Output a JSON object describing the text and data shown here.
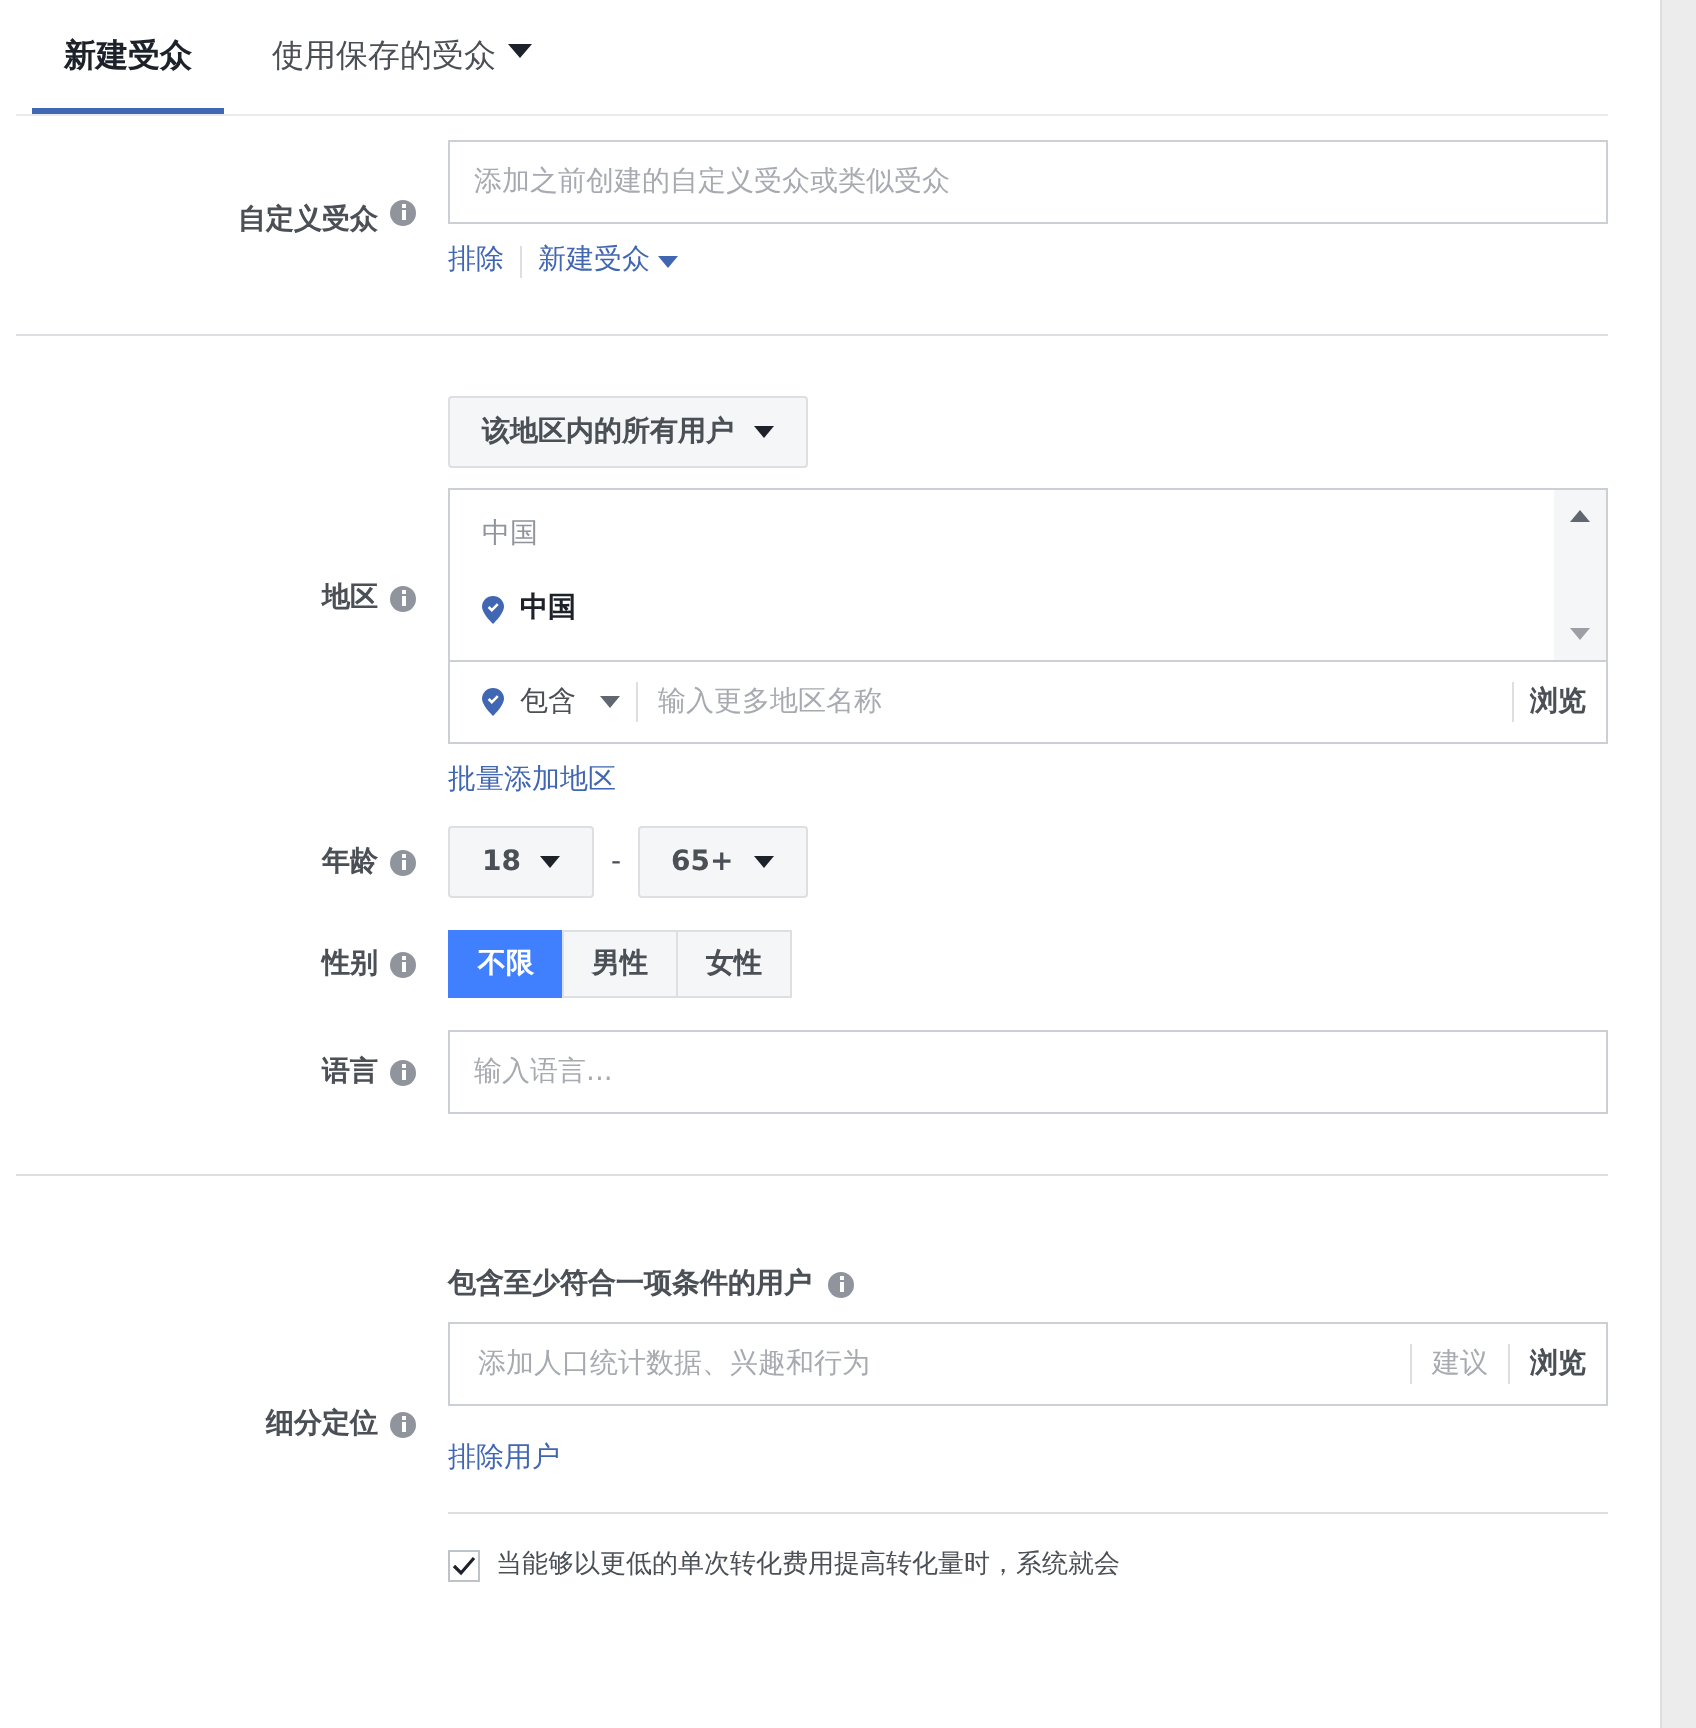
{
  "tabs": [
    {
      "label": "新建受众",
      "selected": true,
      "caret": false
    },
    {
      "label": "使用保存的受众",
      "selected": false,
      "caret": true
    }
  ],
  "custom_audience": {
    "label": "自定义受众",
    "placeholder": "添加之前创建的自定义受众或类似受众",
    "links": [
      {
        "label": "排除",
        "caret": false
      },
      {
        "label": "新建受众",
        "caret": true
      }
    ]
  },
  "location": {
    "label": "地区",
    "scope_dropdown": "该地区内的所有用户",
    "group_header": "中国",
    "items": [
      {
        "label": "中国"
      }
    ],
    "mode_dropdown": "包含",
    "placeholder": "输入更多地区名称",
    "browse": "浏览",
    "bulk_link": "批量添加地区"
  },
  "age": {
    "label": "年龄",
    "min": "18",
    "separator": "-",
    "max": "65+"
  },
  "gender": {
    "label": "性别",
    "options": [
      {
        "label": "不限",
        "selected": true
      },
      {
        "label": "男性",
        "selected": false
      },
      {
        "label": "女性",
        "selected": false
      }
    ]
  },
  "language": {
    "label": "语言",
    "placeholder": "输入语言..."
  },
  "detailed_targeting": {
    "label": "细分定位",
    "heading": "包含至少符合一项条件的用户",
    "placeholder": "添加人口统计数据、兴趣和行为",
    "suggest": "建议",
    "browse": "浏览",
    "exclude_link": "排除用户",
    "expansion": {
      "checked": true,
      "text": "当能够以更低的单次转化费用提高转化量时，系统就会"
    }
  }
}
